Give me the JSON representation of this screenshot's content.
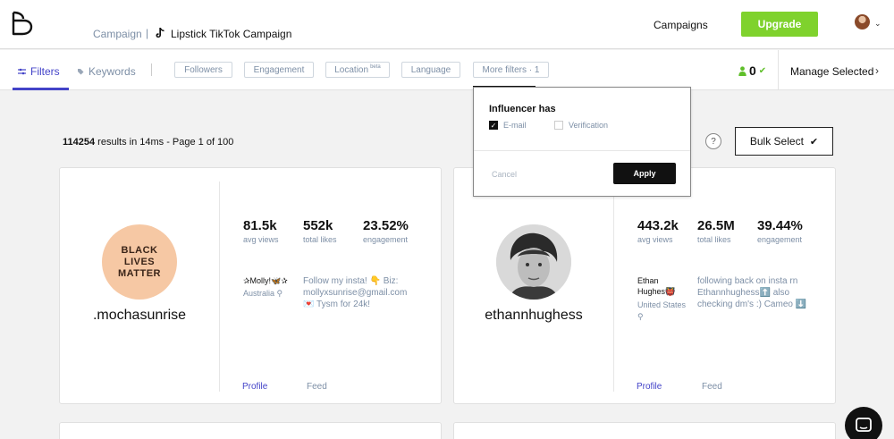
{
  "header": {
    "breadcrumb_campaign": "Campaign",
    "breadcrumb_separator": "|",
    "breadcrumb_current": "Lipstick TikTok Campaign",
    "nav_campaigns": "Campaigns",
    "upgrade_label": "Upgrade"
  },
  "filterbar": {
    "tab_filters": "Filters",
    "tab_keywords": "Keywords",
    "chips": [
      {
        "label": "Followers"
      },
      {
        "label": "Engagement"
      },
      {
        "label": "Location",
        "sup": "beta"
      },
      {
        "label": "Language"
      },
      {
        "label": "More filters · 1"
      }
    ],
    "selected_count": "0",
    "manage_selected": "Manage Selected"
  },
  "results": {
    "count": "114254",
    "text": " results in 14ms - Page 1 of 100"
  },
  "help_label": "?",
  "bulk_select_label": "Bulk Select",
  "bulk_select_check": "✔",
  "popup": {
    "title": "Influencer has",
    "options": [
      {
        "label": "E-mail",
        "checked": true
      },
      {
        "label": "Verification",
        "checked": false
      }
    ],
    "cancel_label": "Cancel",
    "apply_label": "Apply"
  },
  "cards": [
    {
      "username": ".mochasunrise",
      "avatar_text": [
        "BLACK",
        "LIVES",
        "MATTER"
      ],
      "stats": [
        {
          "value": "81.5k",
          "label": "avg views"
        },
        {
          "value": "552k",
          "label": "total likes"
        },
        {
          "value": "23.52%",
          "label": "engagement"
        }
      ],
      "display_name": "✰Molly!🦋✰",
      "location": "Australia",
      "bio": "Follow my insta! 👇 Biz: mollyxsunrise@gmail.com 💌 Tysm for 24k!",
      "profile_label": "Profile",
      "feed_label": "Feed"
    },
    {
      "username": "ethannhughess",
      "stats": [
        {
          "value": "443.2k",
          "label": "avg views"
        },
        {
          "value": "26.5M",
          "label": "total likes"
        },
        {
          "value": "39.44%",
          "label": "engagement"
        }
      ],
      "display_name": "Ethan Hughes👹",
      "location": "United States",
      "bio": "following back on insta rn Ethannhughess⬆️ also checking dm's :) Cameo ⬇️",
      "profile_label": "Profile",
      "feed_label": "Feed"
    }
  ],
  "colors": {
    "accent": "#4343c8",
    "upgrade_green": "#7fd22d",
    "muted_text": "#7d8fa6"
  }
}
